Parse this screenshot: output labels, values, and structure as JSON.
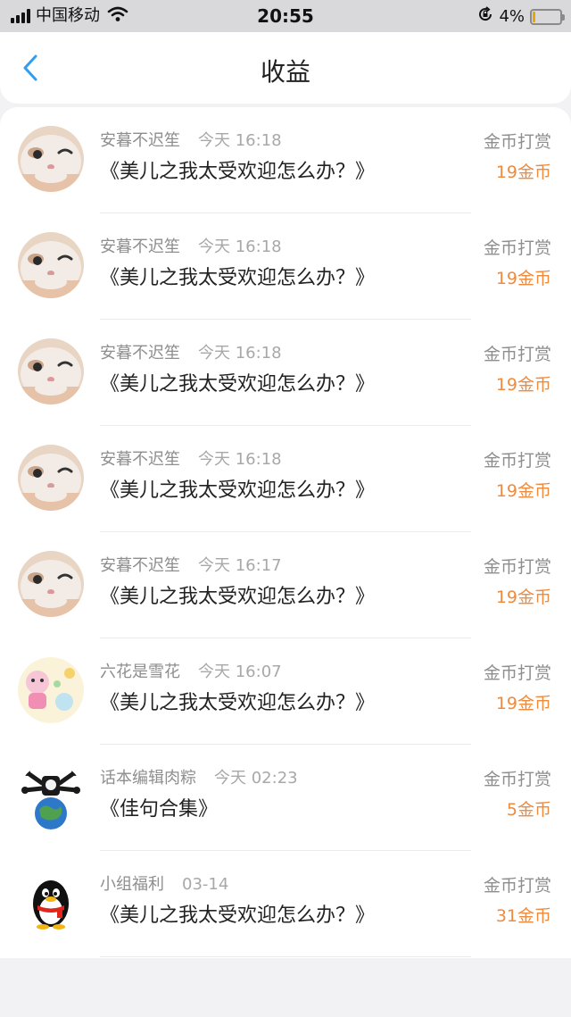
{
  "status_bar": {
    "carrier": "中国移动",
    "time": "20:55",
    "battery_percent": "4%",
    "battery_level": 0.04,
    "icons": [
      "signal-icon",
      "wifi-icon",
      "rotation-lock-icon",
      "battery-icon"
    ]
  },
  "nav": {
    "title": "收益",
    "back_icon": "chevron-left-icon"
  },
  "colors": {
    "accent_blue": "#2f9ef4",
    "amount_orange": "#f08a3c",
    "muted_text": "#8e8e8e"
  },
  "rows": [
    {
      "name": "安暮不迟笙",
      "time": "今天 16:18",
      "book": "《美儿之我太受欢迎怎么办？》",
      "type": "金币打赏",
      "amount": "19金币",
      "avatar": "cat-avatar"
    },
    {
      "name": "安暮不迟笙",
      "time": "今天 16:18",
      "book": "《美儿之我太受欢迎怎么办？》",
      "type": "金币打赏",
      "amount": "19金币",
      "avatar": "cat-avatar"
    },
    {
      "name": "安暮不迟笙",
      "time": "今天 16:18",
      "book": "《美儿之我太受欢迎怎么办？》",
      "type": "金币打赏",
      "amount": "19金币",
      "avatar": "cat-avatar"
    },
    {
      "name": "安暮不迟笙",
      "time": "今天 16:18",
      "book": "《美儿之我太受欢迎怎么办？》",
      "type": "金币打赏",
      "amount": "19金币",
      "avatar": "cat-avatar"
    },
    {
      "name": "安暮不迟笙",
      "time": "今天 16:17",
      "book": "《美儿之我太受欢迎怎么办？》",
      "type": "金币打赏",
      "amount": "19金币",
      "avatar": "cat-avatar"
    },
    {
      "name": "六花是雪花",
      "time": "今天 16:07",
      "book": "《美儿之我太受欢迎怎么办？》",
      "type": "金币打赏",
      "amount": "19金币",
      "avatar": "cartoon-avatar"
    },
    {
      "name": "话本编辑肉粽",
      "time": "今天 02:23",
      "book": "《佳句合集》",
      "type": "金币打赏",
      "amount": "5金币",
      "avatar": "earth-avatar"
    },
    {
      "name": "小组福利",
      "time": "03-14",
      "book": "《美儿之我太受欢迎怎么办？》",
      "type": "金币打赏",
      "amount": "31金币",
      "avatar": "penguin-avatar"
    }
  ]
}
